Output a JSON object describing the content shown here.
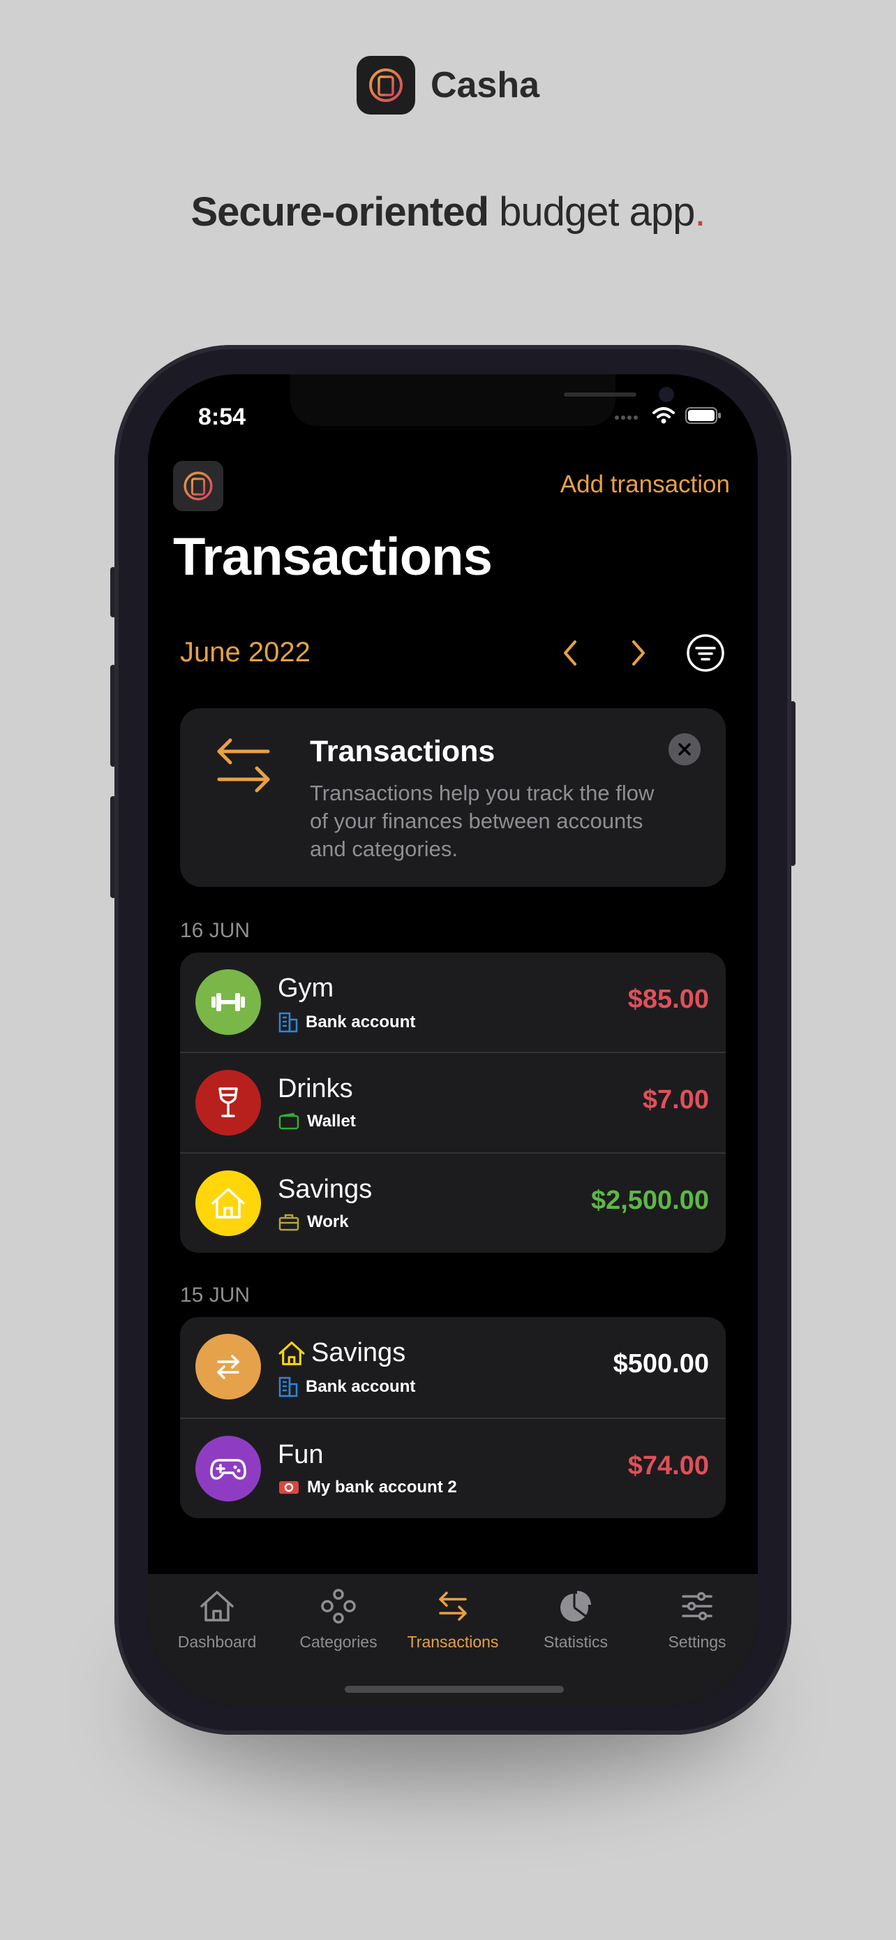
{
  "brand": {
    "name": "Casha"
  },
  "tagline": {
    "bold": "Secure-oriented",
    "rest": " budget app",
    "dot": "."
  },
  "status": {
    "time": "8:54"
  },
  "header": {
    "add_label": "Add transaction",
    "title": "Transactions"
  },
  "period": {
    "month": "June 2022"
  },
  "info_card": {
    "title": "Transactions",
    "text": "Transactions help you track the flow of your finances between accounts and categories."
  },
  "sections": [
    {
      "date": "16 JUN",
      "items": [
        {
          "title": "Gym",
          "account": "Bank account",
          "amount": "$85.00",
          "icon": "dumbbell-icon",
          "icon_color": "#7ab648",
          "amount_color": "#e0505a"
        },
        {
          "title": "Drinks",
          "account": "Wallet",
          "amount": "$7.00",
          "icon": "wine-glass-icon",
          "icon_color": "#b8201d",
          "amount_color": "#e0505a"
        },
        {
          "title": "Savings",
          "account": "Work",
          "amount": "$2,500.00",
          "icon": "house-icon",
          "icon_color": "#ffd60a",
          "amount_color": "#5db846"
        }
      ]
    },
    {
      "date": "15 JUN",
      "items": [
        {
          "title": "Savings",
          "account": "Bank account",
          "amount": "$500.00",
          "icon": "transfer-arrows-icon",
          "icon_color": "#e5a24a",
          "amount_color": "#ffffff"
        },
        {
          "title": "Fun",
          "account": "My bank account 2",
          "amount": "$74.00",
          "icon": "gamepad-icon",
          "icon_color": "#8e3dc2",
          "amount_color": "#e0505a"
        }
      ]
    }
  ],
  "tabs": [
    {
      "label": "Dashboard",
      "icon": "house-icon"
    },
    {
      "label": "Categories",
      "icon": "categories-icon"
    },
    {
      "label": "Transactions",
      "icon": "transfer-arrows-icon",
      "active": true
    },
    {
      "label": "Statistics",
      "icon": "pie-chart-icon"
    },
    {
      "label": "Settings",
      "icon": "sliders-icon"
    }
  ],
  "colors": {
    "accent": "#e7a144",
    "expense": "#e0505a",
    "income": "#5db846",
    "background": "#000000",
    "card": "#1c1c1e"
  }
}
